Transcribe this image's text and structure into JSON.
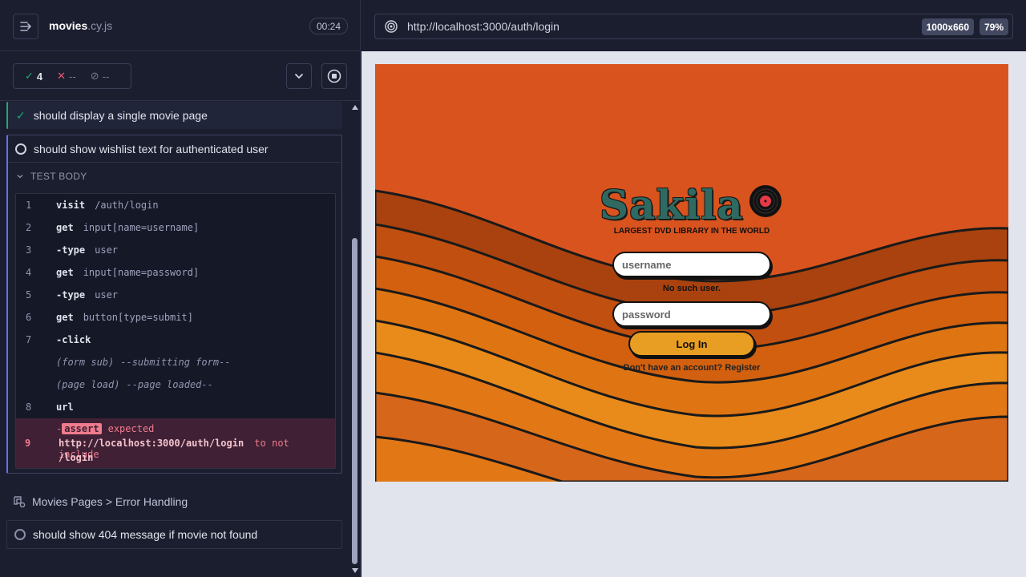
{
  "runner": {
    "spec_name": "movies",
    "spec_ext": ".cy.js",
    "timer": "00:24",
    "stats": {
      "passed": "4",
      "failed": "--",
      "pending": "--"
    }
  },
  "tests": {
    "passed_title": "should display a single movie page",
    "running_title": "should show wishlist text for authenticated user",
    "body_header": "TEST BODY",
    "commands": [
      {
        "num": "1",
        "name": "visit",
        "msg": "/auth/login"
      },
      {
        "num": "2",
        "name": "get",
        "msg": "input[name=username]"
      },
      {
        "num": "3",
        "name": "-type",
        "msg": "user"
      },
      {
        "num": "4",
        "name": "get",
        "msg": "input[name=password]"
      },
      {
        "num": "5",
        "name": "-type",
        "msg": "user"
      },
      {
        "num": "6",
        "name": "get",
        "msg": "button[type=submit]"
      },
      {
        "num": "7",
        "name": "-click",
        "msg": ""
      },
      {
        "num": "",
        "name": "(form sub)",
        "msg": "--submitting form--"
      },
      {
        "num": "",
        "name": "(page load)",
        "msg": "--page loaded--"
      },
      {
        "num": "8",
        "name": "url",
        "msg": ""
      }
    ],
    "error": {
      "num": "9",
      "dash": "-",
      "name": "assert",
      "expected": "expected",
      "url": "http://localhost:3000/auth/login",
      "phrase": "to not include",
      "value": "/login"
    },
    "suite_title": "Movies Pages > Error Handling",
    "pending_title": "should show 404 message if movie not found"
  },
  "browser": {
    "url": "http://localhost:3000/auth/login",
    "viewport": "1000x660",
    "zoom": "79%"
  },
  "app": {
    "logo": "Sakila",
    "tagline": "LARGEST DVD LIBRARY IN THE WORLD",
    "username_placeholder": "username",
    "password_placeholder": "password",
    "error": "No such user.",
    "login_label": "Log In",
    "register_prompt": "Don't have an account? Register"
  },
  "colors": {
    "accent": "#6470f3",
    "pass": "#1fa971",
    "fail": "#e45770",
    "app_bg": "#d9531e",
    "login_button": "#e89e22"
  }
}
